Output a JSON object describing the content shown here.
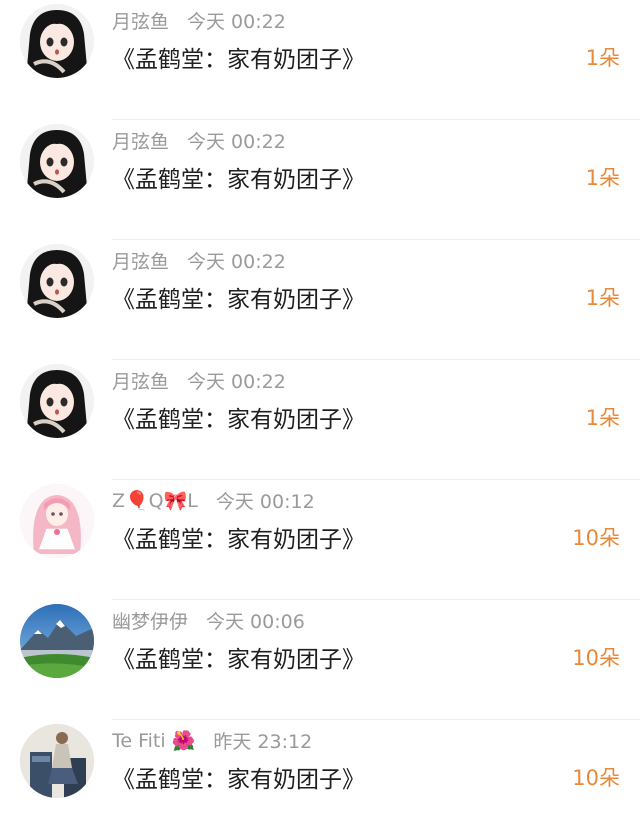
{
  "colors": {
    "count": "#e8883a",
    "name": "#9a9a9a",
    "text": "#1f1f1f"
  },
  "items": [
    {
      "name": "月弦鱼",
      "time": "今天 00:22",
      "gift": "《孟鹤堂：家有奶团子》",
      "count": "1朵",
      "avatar": "anime-girl-dark-hair"
    },
    {
      "name": "月弦鱼",
      "time": "今天 00:22",
      "gift": "《孟鹤堂：家有奶团子》",
      "count": "1朵",
      "avatar": "anime-girl-dark-hair"
    },
    {
      "name": "月弦鱼",
      "time": "今天 00:22",
      "gift": "《孟鹤堂：家有奶团子》",
      "count": "1朵",
      "avatar": "anime-girl-dark-hair"
    },
    {
      "name": "月弦鱼",
      "time": "今天 00:22",
      "gift": "《孟鹤堂：家有奶团子》",
      "count": "1朵",
      "avatar": "anime-girl-dark-hair"
    },
    {
      "name": "Z🎈Q🎀L",
      "time": "今天 00:12",
      "gift": "《孟鹤堂：家有奶团子》",
      "count": "10朵",
      "avatar": "pink-anime-girl"
    },
    {
      "name": "幽梦伊伊",
      "time": "今天 00:06",
      "gift": "《孟鹤堂：家有奶团子》",
      "count": "10朵",
      "avatar": "mountain-landscape"
    },
    {
      "name": "Te Fiti 🌺",
      "time": "昨天 23:12",
      "gift": "《孟鹤堂：家有奶团子》",
      "count": "10朵",
      "avatar": "person-photo"
    }
  ]
}
